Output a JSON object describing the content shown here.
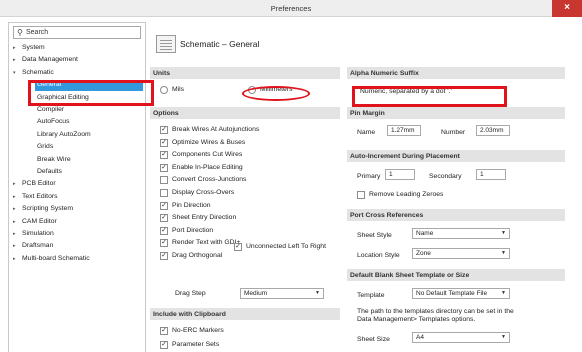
{
  "window": {
    "title": "Preferences",
    "close_label": "×"
  },
  "search": {
    "placeholder": "Search"
  },
  "tree": [
    {
      "label": "System",
      "arrow": "▸"
    },
    {
      "label": "Data Management",
      "arrow": "▸"
    },
    {
      "label": "Schematic",
      "arrow": "▾"
    },
    {
      "label": "General",
      "arrow": ""
    },
    {
      "label": "Graphical Editing",
      "arrow": ""
    },
    {
      "label": "Compiler",
      "arrow": ""
    },
    {
      "label": "AutoFocus",
      "arrow": ""
    },
    {
      "label": "Library AutoZoom",
      "arrow": ""
    },
    {
      "label": "Grids",
      "arrow": ""
    },
    {
      "label": "Break Wire",
      "arrow": ""
    },
    {
      "label": "Defaults",
      "arrow": ""
    },
    {
      "label": "PCB Editor",
      "arrow": "▸"
    },
    {
      "label": "Text Editors",
      "arrow": "▸"
    },
    {
      "label": "Scripting System",
      "arrow": "▸"
    },
    {
      "label": "CAM Editor",
      "arrow": "▸"
    },
    {
      "label": "Simulation",
      "arrow": "▸"
    },
    {
      "label": "Draftsman",
      "arrow": "▸"
    },
    {
      "label": "Multi-board Schematic",
      "arrow": "▸"
    }
  ],
  "page": {
    "title": "Schematic – General"
  },
  "units": {
    "header": "Units",
    "mils": "Mils",
    "millimeters": "Millimeters"
  },
  "options": {
    "header": "Options",
    "items": [
      {
        "label": "Break Wires At Autojunctions",
        "checked": "✓"
      },
      {
        "label": "Optimize Wires & Buses",
        "checked": "✓"
      },
      {
        "label": "Components Cut Wires",
        "checked": "✓"
      },
      {
        "label": "Enable In-Place Editing",
        "checked": "✓"
      },
      {
        "label": "Convert Cross-Junctions",
        "checked": ""
      },
      {
        "label": "Display Cross-Overs",
        "checked": ""
      },
      {
        "label": "Pin Direction",
        "checked": "✓"
      },
      {
        "label": "Sheet Entry Direction",
        "checked": "✓"
      },
      {
        "label": "Port Direction",
        "checked": "✓"
      },
      {
        "label": "Render Text with GDI+",
        "checked": "✓"
      },
      {
        "label": "Drag Orthogonal",
        "checked": "✓"
      }
    ],
    "unconnected": {
      "label": "Unconnected Left To Right",
      "checked": "✓"
    },
    "drag_step_label": "Drag Step",
    "drag_step_value": "Medium"
  },
  "clipboard": {
    "header": "Include with Clipboard",
    "items": [
      {
        "label": "No-ERC Markers",
        "checked": "✓"
      },
      {
        "label": "Parameter Sets",
        "checked": "✓"
      }
    ]
  },
  "alpha": {
    "header": "Alpha Numeric Suffix",
    "value": "Numeric, separated by a dot '.'"
  },
  "pin_margin": {
    "header": "Pin Margin",
    "name_label": "Name",
    "name_value": "1.27mm",
    "number_label": "Number",
    "number_value": "2.03mm"
  },
  "auto_increment": {
    "header": "Auto-Increment During Placement",
    "primary_label": "Primary",
    "primary_value": "1",
    "secondary_label": "Secondary",
    "secondary_value": "1",
    "remove_zeroes": "Remove Leading Zeroes"
  },
  "port_refs": {
    "header": "Port Cross References",
    "sheet_style_label": "Sheet Style",
    "sheet_style_value": "Name",
    "location_style_label": "Location Style",
    "location_style_value": "Zone"
  },
  "template": {
    "header": "Default Blank Sheet Template or Size",
    "template_label": "Template",
    "template_value": "No Default Template File",
    "note": "The path to the templates directory can be set in the Data Management> Templates options.",
    "sheet_size_label": "Sheet Size",
    "sheet_size_value": "A4"
  },
  "colors": {
    "selection": "#3399dd",
    "annotation_red": "#e0121c",
    "close_red": "#c7372f"
  }
}
